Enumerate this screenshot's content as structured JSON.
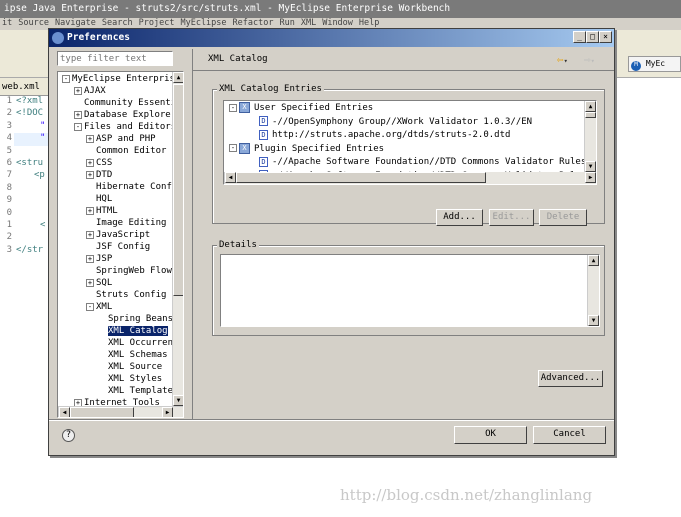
{
  "window": {
    "title": "ipse Java Enterprise - struts2/src/struts.xml - MyEclipse Enterprise Workbench",
    "menu": [
      "it",
      "Source",
      "Navigate",
      "Search",
      "Project",
      "MyEclipse",
      "Refactor",
      "Run",
      "XML",
      "Window",
      "Help"
    ],
    "editor_tab": "web.xml",
    "perspective": "MyEc",
    "line_numbers": [
      "1",
      "2",
      "3",
      "4",
      "5",
      "6",
      "7",
      "8",
      "9",
      "0",
      "1",
      "2",
      "3"
    ],
    "code_lines": [
      "<?xml",
      "<!DOC",
      "\"",
      "\"",
      "",
      "<stru",
      "<p",
      "",
      "",
      "",
      "<",
      "",
      "</str"
    ]
  },
  "dialog": {
    "title": "Preferences",
    "filter_placeholder": "type filter text",
    "tree": [
      {
        "label": "MyEclipse Enterprise W",
        "level": 0,
        "toggle": "-"
      },
      {
        "label": "AJAX",
        "level": 1,
        "toggle": "+"
      },
      {
        "label": "Community Essential",
        "level": 1,
        "toggle": ""
      },
      {
        "label": "Database Explorer",
        "level": 1,
        "toggle": "+"
      },
      {
        "label": "Files and Editors",
        "level": 1,
        "toggle": "-"
      },
      {
        "label": "ASP and PHP",
        "level": 2,
        "toggle": "+"
      },
      {
        "label": "Common Editor Pr",
        "level": 2,
        "toggle": ""
      },
      {
        "label": "CSS",
        "level": 2,
        "toggle": "+"
      },
      {
        "label": "DTD",
        "level": 2,
        "toggle": "+"
      },
      {
        "label": "Hibernate Config",
        "level": 2,
        "toggle": ""
      },
      {
        "label": "HQL",
        "level": 2,
        "toggle": ""
      },
      {
        "label": "HTML",
        "level": 2,
        "toggle": "+"
      },
      {
        "label": "Image Editing",
        "level": 2,
        "toggle": ""
      },
      {
        "label": "JavaScript",
        "level": 2,
        "toggle": "+"
      },
      {
        "label": "JSF Config",
        "level": 2,
        "toggle": ""
      },
      {
        "label": "JSP",
        "level": 2,
        "toggle": "+"
      },
      {
        "label": "SpringWeb Flow",
        "level": 2,
        "toggle": ""
      },
      {
        "label": "SQL",
        "level": 2,
        "toggle": "+"
      },
      {
        "label": "Struts Config",
        "level": 2,
        "toggle": ""
      },
      {
        "label": "XML",
        "level": 2,
        "toggle": "-"
      },
      {
        "label": "Spring Beans",
        "level": 3,
        "toggle": ""
      },
      {
        "label": "XML Catalog",
        "level": 3,
        "toggle": "",
        "selected": true
      },
      {
        "label": "XML Occurrenc",
        "level": 3,
        "toggle": ""
      },
      {
        "label": "XML Schemas",
        "level": 3,
        "toggle": ""
      },
      {
        "label": "XML Source",
        "level": 3,
        "toggle": ""
      },
      {
        "label": "XML Styles",
        "level": 3,
        "toggle": ""
      },
      {
        "label": "XML Templates",
        "level": 3,
        "toggle": ""
      },
      {
        "label": "Internet Tools",
        "level": 1,
        "toggle": "+"
      }
    ],
    "page_title": "XML Catalog",
    "entries_group": "XML Catalog Entries",
    "entries": [
      {
        "label": "User Specified Entries",
        "type": "group"
      },
      {
        "label": "-//OpenSymphony Group//XWork Validator 1.0.3//EN",
        "type": "entry"
      },
      {
        "label": "http://struts.apache.org/dtds/struts-2.0.dtd",
        "type": "entry"
      },
      {
        "label": "Plugin Specified Entries",
        "type": "group"
      },
      {
        "label": "-//Apache Software Foundation//DTD Commons Validator Rules Configu",
        "type": "entry"
      },
      {
        "label": "-//Apache Software Foundation//DTD Commons Validator Rules Configu",
        "type": "entry"
      }
    ],
    "add": "Add...",
    "edit": "Edit...",
    "delete": "Delete",
    "details_group": "Details",
    "advanced": "Advanced...",
    "ok": "OK",
    "cancel": "Cancel",
    "help": "?"
  },
  "watermark": "http://blog.csdn.net/zhanglinlang"
}
